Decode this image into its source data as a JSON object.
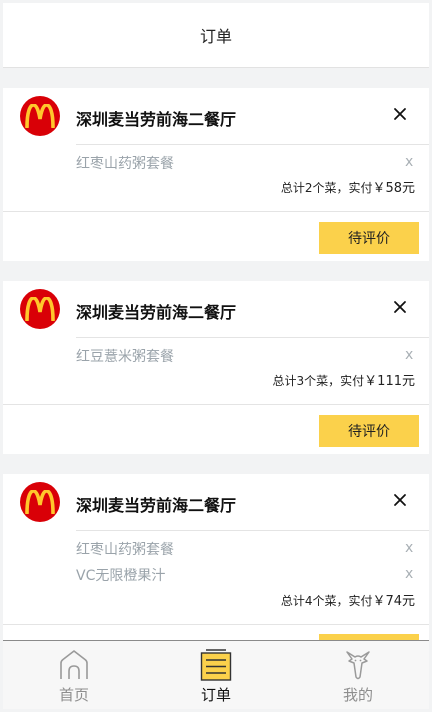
{
  "header": {
    "title": "订单"
  },
  "orders": [
    {
      "store": "深圳麦当劳前海二餐厅",
      "items": [
        {
          "name": "红枣山药粥套餐",
          "remove": "x"
        }
      ],
      "summary_prefix": "总计2个菜，实付",
      "price": "￥58元",
      "action": "待评价"
    },
    {
      "store": "深圳麦当劳前海二餐厅",
      "items": [
        {
          "name": "红豆薏米粥套餐",
          "remove": "x"
        }
      ],
      "summary_prefix": "总计3个菜，实付",
      "price": "￥111元",
      "action": "待评价"
    },
    {
      "store": "深圳麦当劳前海二餐厅",
      "items": [
        {
          "name": "红枣山药粥套餐",
          "remove": "x"
        },
        {
          "name": "VC无限橙果汁",
          "remove": "x"
        }
      ],
      "summary_prefix": "总计4个菜，实付",
      "price": "￥74元",
      "action": ""
    }
  ],
  "tabs": [
    {
      "label": "首页",
      "icon": "home-icon",
      "active": false
    },
    {
      "label": "订单",
      "icon": "order-list-icon",
      "active": true
    },
    {
      "label": "我的",
      "icon": "profile-icon",
      "active": false
    }
  ],
  "colors": {
    "accent": "#fbd14b",
    "brand_red": "#d90007",
    "brand_yellow": "#ffc72c",
    "muted_text": "#9aa3aa"
  }
}
